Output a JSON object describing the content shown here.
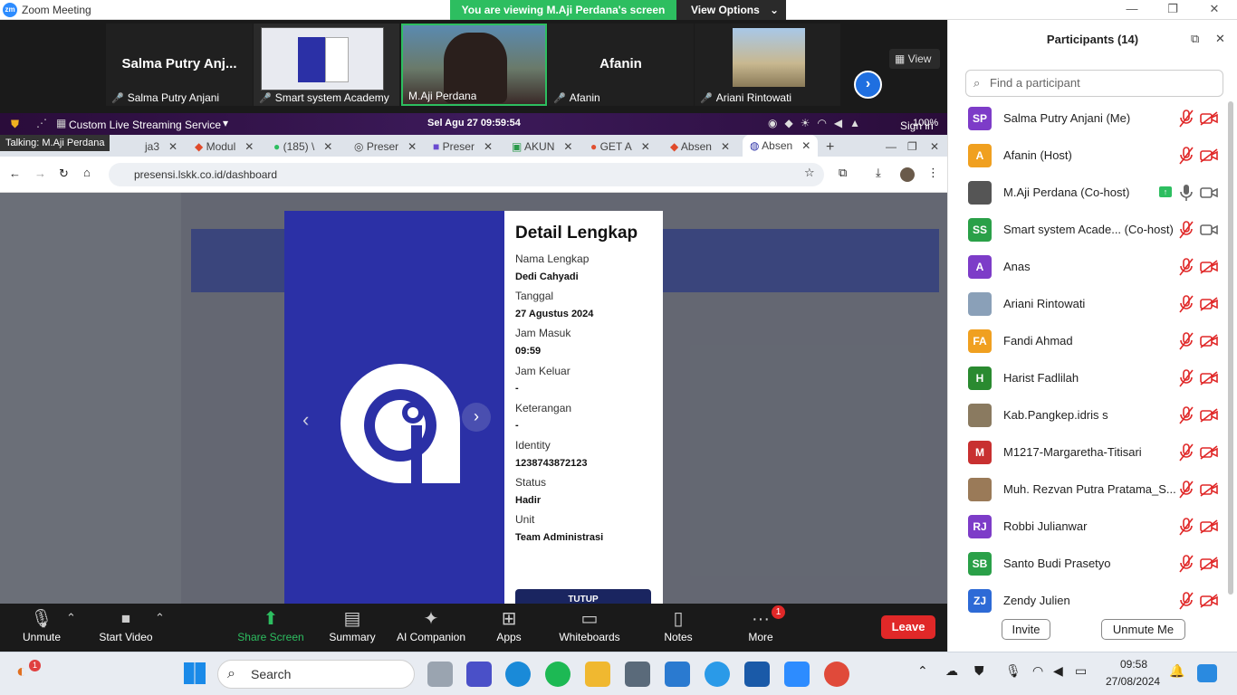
{
  "app_title": "Zoom Meeting",
  "banner": {
    "viewing": "You are viewing M.Aji Perdana's screen",
    "view_options": "View Options"
  },
  "strip": {
    "tiles": [
      {
        "name": "Salma Putry Anj...",
        "label": "Salma Putry Anjani"
      },
      {
        "name": "",
        "label": "Smart system Academy"
      },
      {
        "name": "",
        "label": "M.Aji Perdana"
      },
      {
        "name": "Afanin",
        "label": "Afanin"
      },
      {
        "name": "",
        "label": "Ariani Rintowati"
      }
    ],
    "view_label": "View"
  },
  "shared": {
    "service": "Custom Live Streaming Service",
    "clock": "Sel Agu 27  09:59:54",
    "battery": "100%",
    "talking": "Talking: M.Aji Perdana",
    "signin": "Sign in",
    "tabs": [
      "ja3",
      "Modul",
      "(185) \\",
      "Preser",
      "Preser",
      "AKUN",
      "GET A",
      "Absen",
      "Absen"
    ],
    "url": "presensi.lskk.co.id/dashboard",
    "modal": {
      "title": "Detail Lengkap",
      "fields": [
        {
          "label": "Nama Lengkap",
          "value": "Dedi Cahyadi"
        },
        {
          "label": "Tanggal",
          "value": "27 Agustus 2024"
        },
        {
          "label": "Jam Masuk",
          "value": "09:59"
        },
        {
          "label": "Jam Keluar",
          "value": "-"
        },
        {
          "label": "Keterangan",
          "value": "-"
        },
        {
          "label": "Identity",
          "value": "1238743872123"
        },
        {
          "label": "Status",
          "value": "Hadir"
        },
        {
          "label": "Unit",
          "value": "Team Administrasi"
        }
      ],
      "close": "TUTUP"
    }
  },
  "participants": {
    "header": "Participants (14)",
    "search_placeholder": "Find a participant",
    "list": [
      {
        "initials": "SP",
        "name": "Salma Putry Anjani (Me)",
        "color": "#7d3cc8"
      },
      {
        "initials": "A",
        "name": "Afanin (Host)",
        "color": "#f0a020"
      },
      {
        "initials": "",
        "name": "M.Aji Perdana (Co-host)",
        "color": "#555555"
      },
      {
        "initials": "SS",
        "name": "Smart system Acade...   (Co-host)",
        "color": "#2aa048"
      },
      {
        "initials": "A",
        "name": "Anas",
        "color": "#7d3cc8"
      },
      {
        "initials": "",
        "name": "Ariani Rintowati",
        "color": "#8aa0b8"
      },
      {
        "initials": "FA",
        "name": "Fandi Ahmad",
        "color": "#f0a020"
      },
      {
        "initials": "H",
        "name": "Harist Fadlilah",
        "color": "#2a8a30"
      },
      {
        "initials": "",
        "name": "Kab.Pangkep.idris s",
        "color": "#8a7a60"
      },
      {
        "initials": "M",
        "name": "M1217-Margaretha-Titisari",
        "color": "#c83030"
      },
      {
        "initials": "",
        "name": "Muh. Rezvan Putra Pratama_S...",
        "color": "#9a7a58"
      },
      {
        "initials": "RJ",
        "name": "Robbi Julianwar",
        "color": "#7d3cc8"
      },
      {
        "initials": "SB",
        "name": "Santo Budi Prasetyo",
        "color": "#2aa048"
      },
      {
        "initials": "ZJ",
        "name": "Zendy Julien",
        "color": "#2d6ad6"
      }
    ],
    "invite": "Invite",
    "unmute_me": "Unmute Me"
  },
  "controls": [
    {
      "label": "Unmute",
      "icon": "mic-muted-icon"
    },
    {
      "label": "Start Video",
      "icon": "video-off-icon"
    },
    {
      "label": "Share Screen",
      "icon": "share-screen-icon"
    },
    {
      "label": "Summary",
      "icon": "summary-icon"
    },
    {
      "label": "AI Companion",
      "icon": "sparkle-icon"
    },
    {
      "label": "Apps",
      "icon": "apps-icon"
    },
    {
      "label": "Whiteboards",
      "icon": "whiteboard-icon"
    },
    {
      "label": "Notes",
      "icon": "notes-icon"
    },
    {
      "label": "More",
      "icon": "more-icon"
    }
  ],
  "more_badge": "1",
  "leave": "Leave",
  "taskbar": {
    "search": "Search",
    "time": "09:58",
    "date": "27/08/2024",
    "notif_badge": "1"
  },
  "colors": {
    "zoom_blue": "#2d8cff",
    "green": "#2dbe60",
    "leave_red": "#e02828",
    "modal_blue": "#2b30a6"
  }
}
